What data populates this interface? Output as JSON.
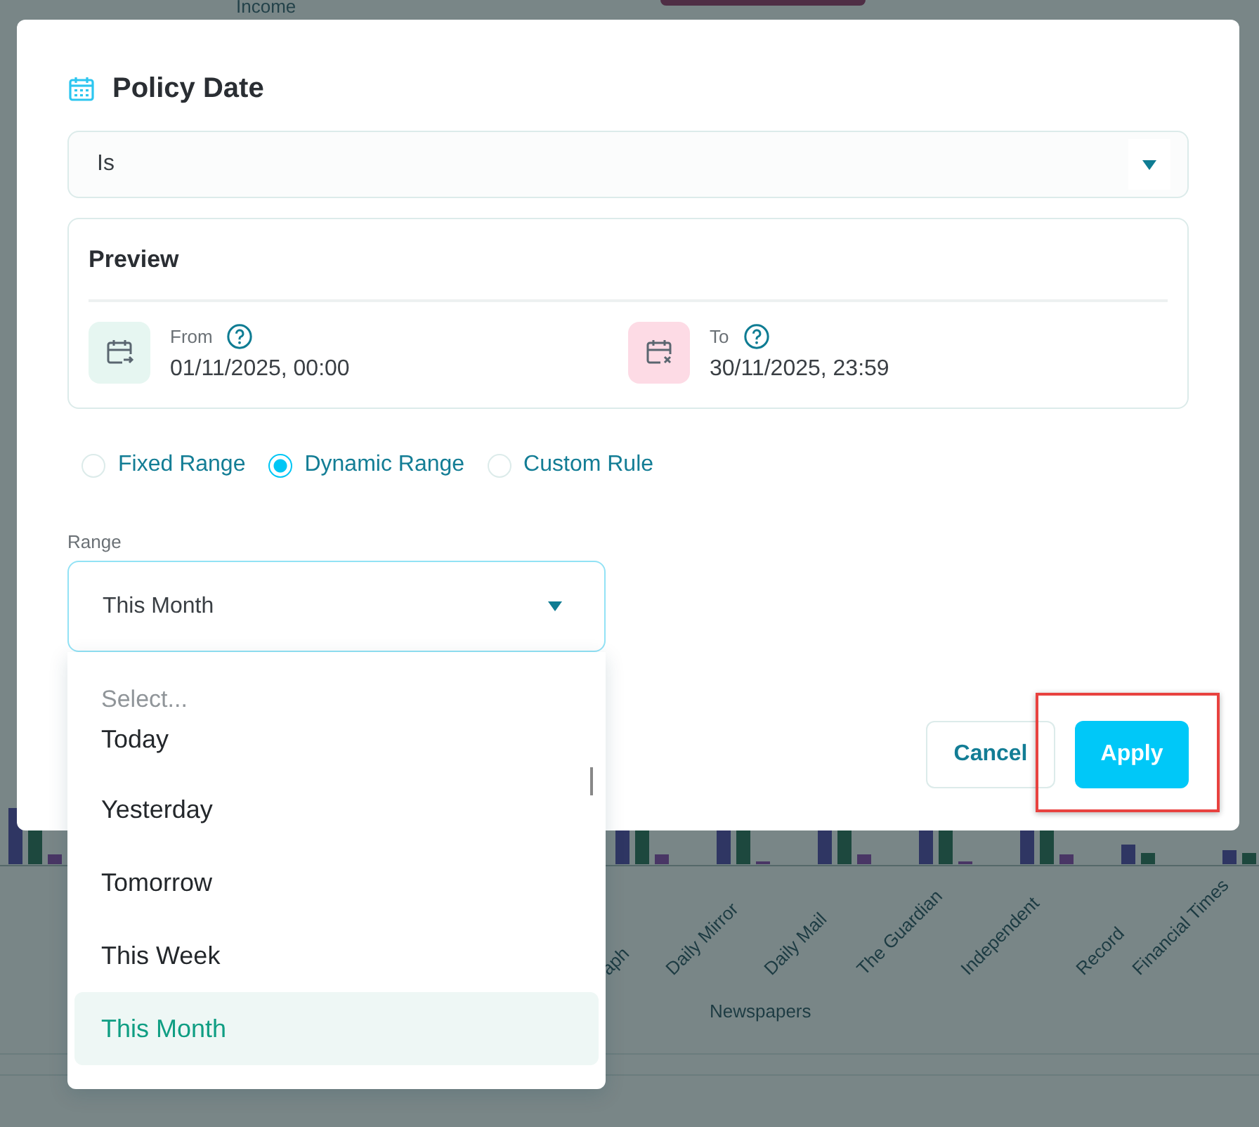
{
  "background": {
    "legend_label": "Income",
    "x_labels": [
      "aph",
      "Daily Mirror",
      "Daily Mail",
      "The Guardian",
      "Independent",
      "Record",
      "Financial Times"
    ],
    "x_axis_title": "Newspapers"
  },
  "dialog": {
    "title": "Policy Date",
    "operator": {
      "value": "Is"
    },
    "preview": {
      "title": "Preview",
      "from": {
        "label": "From",
        "value": "01/11/2025, 00:00"
      },
      "to": {
        "label": "To",
        "value": "30/11/2025, 23:59"
      }
    },
    "modes": [
      {
        "label": "Fixed Range",
        "selected": false
      },
      {
        "label": "Dynamic Range",
        "selected": true
      },
      {
        "label": "Custom Rule",
        "selected": false
      }
    ],
    "range": {
      "label": "Range",
      "value": "This Month",
      "expanded": true,
      "placeholder": "Select...",
      "options": [
        {
          "label": "Today",
          "selected": false
        },
        {
          "label": "Yesterday",
          "selected": false
        },
        {
          "label": "Tomorrow",
          "selected": false
        },
        {
          "label": "This Week",
          "selected": false
        },
        {
          "label": "This Month",
          "selected": true
        }
      ]
    },
    "buttons": [
      {
        "label": "Cancel",
        "kind": "secondary",
        "highlighted": false
      },
      {
        "label": "Apply",
        "kind": "primary",
        "highlighted": true
      }
    ]
  }
}
